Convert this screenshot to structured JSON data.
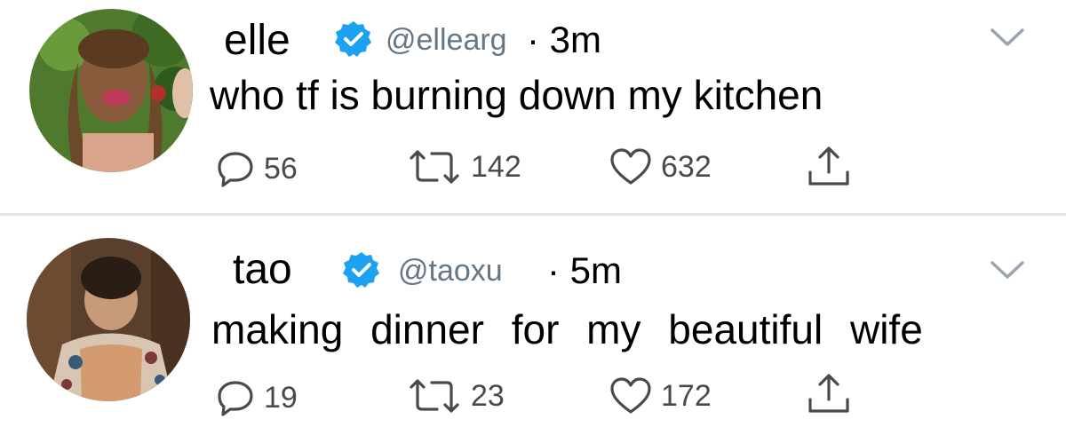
{
  "tweets": [
    {
      "name": "elle",
      "handle": "@ellearg",
      "time": "· 3m",
      "text": "who tf is burning down my kitchen",
      "replies": "56",
      "retweets": "142",
      "likes": "632"
    },
    {
      "name": "tao",
      "handle": "@taoxu",
      "time": "· 5m",
      "text": "making dinner for my beautiful wife",
      "replies": "19",
      "retweets": "23",
      "likes": "172"
    }
  ],
  "icons": {
    "verified": "verified-badge-icon",
    "menu": "chevron-down-icon",
    "reply": "reply-icon",
    "retweet": "retweet-icon",
    "like": "heart-icon",
    "share": "share-icon"
  },
  "colors": {
    "verified_blue": "#1da1f2",
    "muted_text": "#657786",
    "icon_gray": "#4a4a4a"
  }
}
